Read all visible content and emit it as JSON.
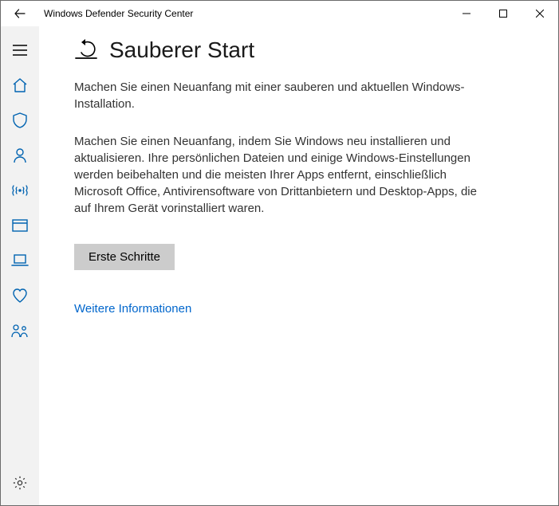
{
  "window": {
    "title": "Windows Defender Security Center"
  },
  "page": {
    "heading": "Sauberer Start",
    "lead": "Machen Sie einen Neuanfang mit einer sauberen und aktuellen Windows-Installation.",
    "body": "Machen Sie einen Neuanfang, indem Sie Windows neu installieren und aktualisieren. Ihre persönlichen Dateien und einige Windows-Einstellungen werden beibehalten und die meisten Ihrer Apps entfernt, einschließlich Microsoft Office, Antivirensoftware von Drittanbietern und Desktop-Apps, die auf Ihrem Gerät vorinstalliert waren.",
    "primary_button": "Erste Schritte",
    "link": "Weitere Informationen"
  }
}
